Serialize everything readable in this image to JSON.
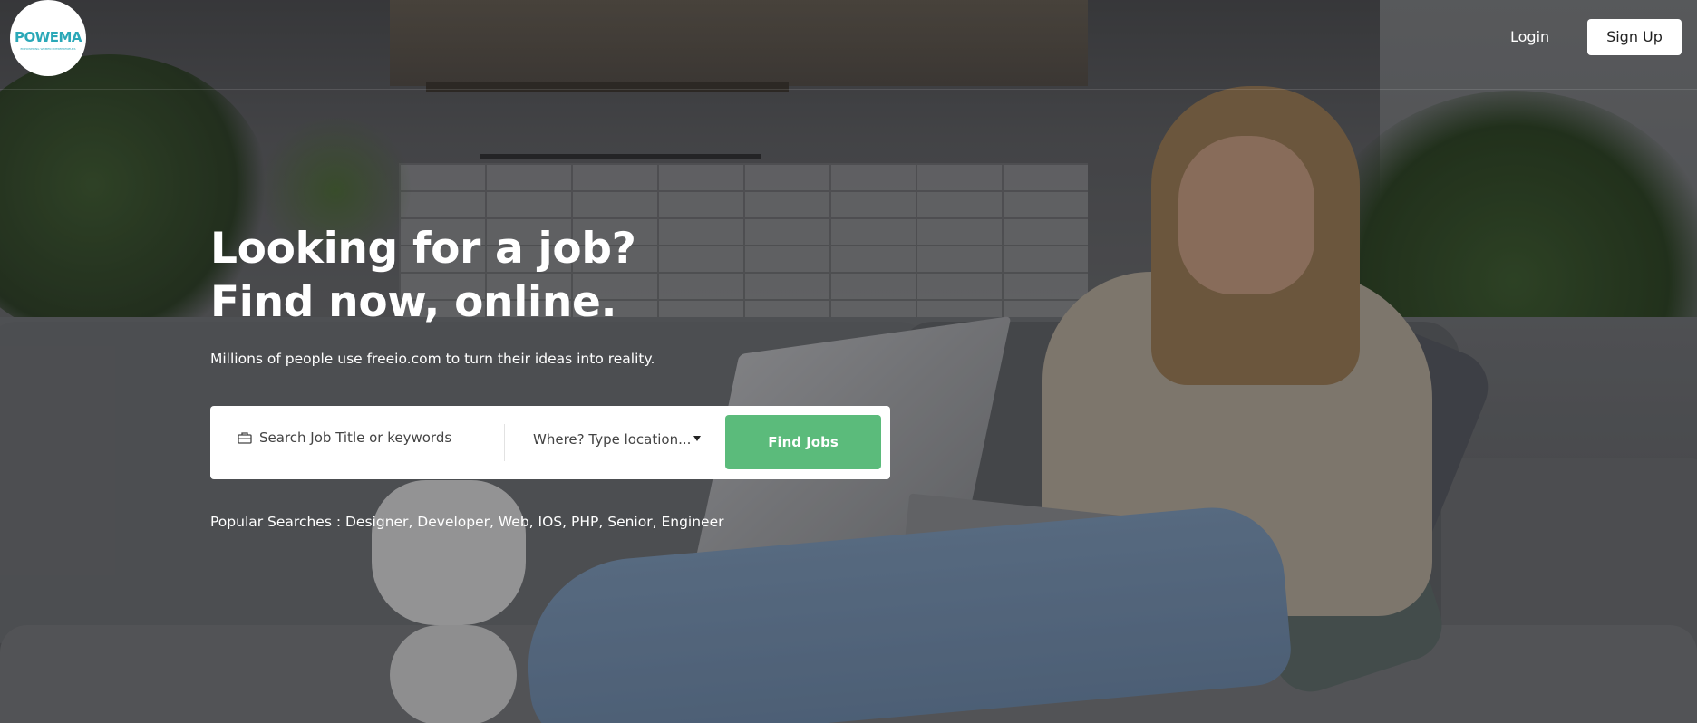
{
  "brand": {
    "logo_text": "POWEMA",
    "logo_tagline": "EMPOWERING WOMEN ENTREPRENEURS"
  },
  "nav": {
    "login_label": "Login",
    "signup_label": "Sign Up"
  },
  "hero": {
    "headline_line1": "Looking for a job?",
    "headline_line2": "Find now, online.",
    "subtitle": "Millions of people use freeio.com to turn their ideas into reality."
  },
  "search": {
    "keyword_placeholder": "Search Job Title or keywords",
    "location_placeholder": "Where? Type location...",
    "button_label": "Find Jobs"
  },
  "popular": {
    "label": "Popular Searches :",
    "terms": [
      "Designer",
      "Developer",
      "Web",
      "IOS",
      "PHP",
      "Senior",
      "Engineer"
    ]
  },
  "colors": {
    "accent": "#5bbb7b",
    "logo": "#2aa8b8"
  },
  "icons": {
    "keyword": "briefcase-icon",
    "location_caret": "caret-down-icon"
  }
}
